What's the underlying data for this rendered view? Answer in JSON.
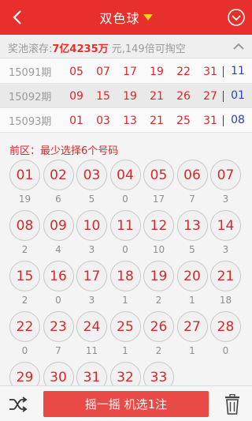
{
  "colors": {
    "brand": "#e7302c",
    "red_number": "#d8282a",
    "blue_number": "#2a46a8",
    "caret": "#ffd21e"
  },
  "header": {
    "title": "双色球",
    "back_icon": "chevron-left-icon",
    "menu_icon": "chevron-down-circle-icon"
  },
  "pool": {
    "prefix": "奖池滚存:",
    "amount": "7亿4235万",
    "suffix": " 元,149倍可掏空"
  },
  "history": [
    {
      "issue": "15091期",
      "reds": [
        "05",
        "07",
        "17",
        "19",
        "22",
        "31"
      ],
      "blue": "11"
    },
    {
      "issue": "15092期",
      "reds": [
        "09",
        "15",
        "19",
        "21",
        "26",
        "27"
      ],
      "blue": "01"
    },
    {
      "issue": "15093期",
      "reds": [
        "01",
        "03",
        "13",
        "21",
        "25",
        "31"
      ],
      "blue": "08"
    }
  ],
  "zone_label": "前区：最少选择6个号码",
  "balls": [
    {
      "n": "01",
      "c": "19"
    },
    {
      "n": "02",
      "c": "6"
    },
    {
      "n": "03",
      "c": "5"
    },
    {
      "n": "04",
      "c": "0"
    },
    {
      "n": "05",
      "c": "17"
    },
    {
      "n": "06",
      "c": "7"
    },
    {
      "n": "07",
      "c": "3"
    },
    {
      "n": "08",
      "c": "2"
    },
    {
      "n": "09",
      "c": "4"
    },
    {
      "n": "10",
      "c": "3"
    },
    {
      "n": "11",
      "c": "0"
    },
    {
      "n": "12",
      "c": "10"
    },
    {
      "n": "13",
      "c": "5"
    },
    {
      "n": "14",
      "c": "3"
    },
    {
      "n": "15",
      "c": "2"
    },
    {
      "n": "16",
      "c": "0"
    },
    {
      "n": "17",
      "c": "3"
    },
    {
      "n": "18",
      "c": "1"
    },
    {
      "n": "19",
      "c": "2"
    },
    {
      "n": "20",
      "c": "1"
    },
    {
      "n": "21",
      "c": "18"
    },
    {
      "n": "22",
      "c": "0"
    },
    {
      "n": "23",
      "c": "7"
    },
    {
      "n": "24",
      "c": "11"
    },
    {
      "n": "25",
      "c": "1"
    },
    {
      "n": "26",
      "c": "2"
    },
    {
      "n": "27",
      "c": "1"
    },
    {
      "n": "28",
      "c": "0"
    },
    {
      "n": "29",
      "c": ""
    },
    {
      "n": "30",
      "c": ""
    },
    {
      "n": "31",
      "c": ""
    },
    {
      "n": "32",
      "c": ""
    },
    {
      "n": "33",
      "c": ""
    }
  ],
  "bottom": {
    "shake_label": "摇一摇 机选1注",
    "shuffle_icon": "shuffle-icon",
    "trash_icon": "trash-icon"
  }
}
